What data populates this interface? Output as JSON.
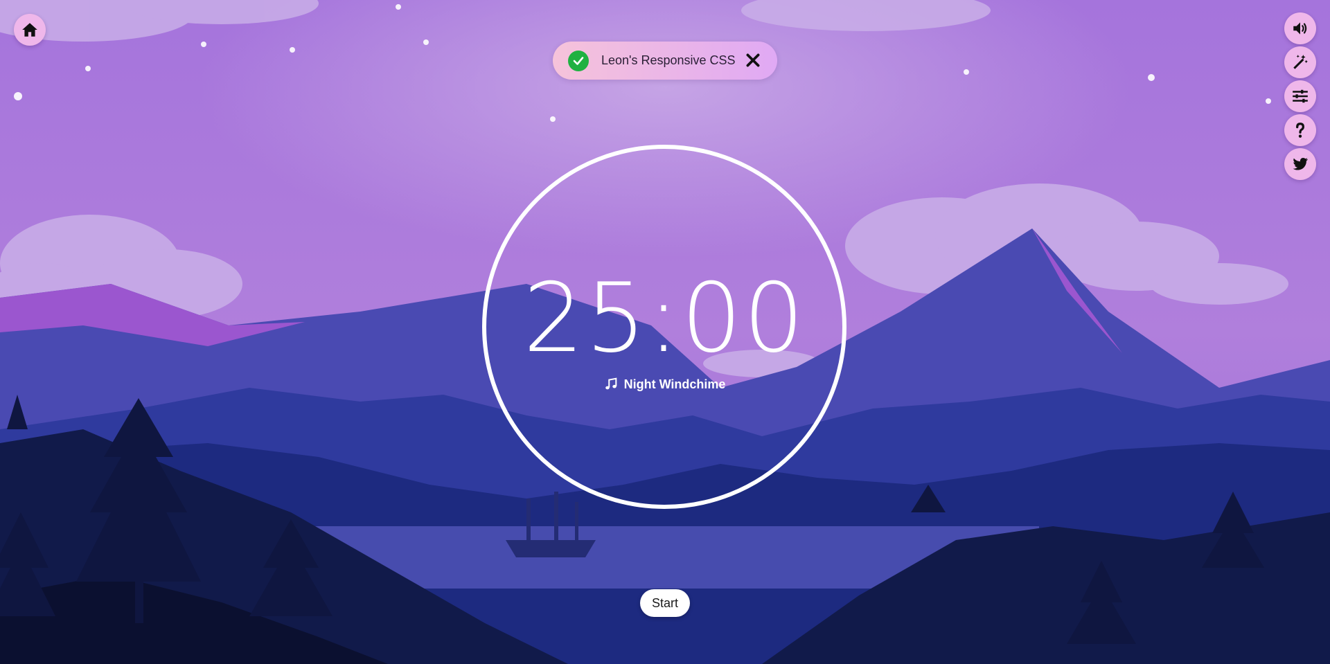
{
  "toast": {
    "message": "Leon's Responsive CSS"
  },
  "timer": {
    "time": "25:00",
    "track_name": "Night Windchime"
  },
  "controls": {
    "start_label": "Start"
  },
  "icons": {
    "home": "home-icon",
    "volume": "volume-icon",
    "theme": "magic-wand-icon",
    "settings": "sliders-icon",
    "help": "question-icon",
    "social": "twitter-icon",
    "music": "music-note-icon",
    "check": "check-icon",
    "close": "close-icon"
  },
  "colors": {
    "button_bg": "#efb7ea",
    "toast_from": "#f6c3da",
    "toast_to": "#e0a9f4",
    "success": "#1fb141",
    "ring": "#ffffff"
  }
}
